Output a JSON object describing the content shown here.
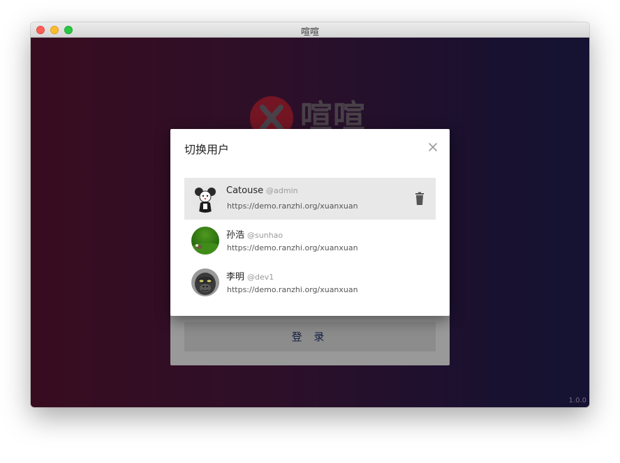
{
  "window": {
    "title": "喧喧"
  },
  "app": {
    "logo_text": "喧喧",
    "login_button": "登 录",
    "version": "1.0.0"
  },
  "dialog": {
    "title": "切换用户",
    "users": [
      {
        "name": "Catouse",
        "handle": "@admin",
        "url": "https://demo.ranzhi.org/xuanxuan",
        "selected": true,
        "avatar": "mouse-avatar"
      },
      {
        "name": "孙浩",
        "handle": "@sunhao",
        "url": "https://demo.ranzhi.org/xuanxuan",
        "selected": false,
        "avatar": "grass-avatar"
      },
      {
        "name": "李明",
        "handle": "@dev1",
        "url": "https://demo.ranzhi.org/xuanxuan",
        "selected": false,
        "avatar": "gorilla-avatar"
      }
    ]
  },
  "colors": {
    "gradient_start": "#5e1535",
    "gradient_end": "#241e55",
    "logo_red": "#c0233b",
    "login_text": "#253670",
    "selected_row": "#e8e8e8"
  },
  "icons": [
    "close-icon",
    "trash-icon"
  ]
}
